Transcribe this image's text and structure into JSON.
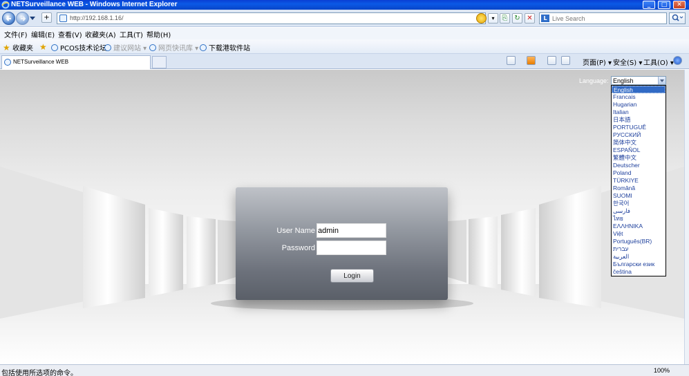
{
  "window": {
    "title": "NETSurveillance WEB - Windows Internet Explorer",
    "min": "_",
    "max": "□",
    "close": "✕"
  },
  "address": {
    "url": "http://192.168.1.16/",
    "search_placeholder": "Live Search"
  },
  "menu": [
    "文件(F)",
    "编辑(E)",
    "查看(V)",
    "收藏夹(A)",
    "工具(T)",
    "帮助(H)"
  ],
  "favorites": {
    "label": "收藏夹",
    "items": [
      "PCOS技术论坛",
      "建议网站 ▾",
      "网页快讯库 ▾",
      "下载港软件站"
    ]
  },
  "tab": {
    "title": "NETSurveillance WEB"
  },
  "commandbar": {
    "page": "页面(P) ▾",
    "safety": "安全(S) ▾",
    "tools": "工具(O) ▾"
  },
  "language": {
    "label": "Language:",
    "selected": "English",
    "options": [
      "English",
      "Francais",
      "Hugarian",
      "Italian",
      "日本語",
      "PORTUGUÊ",
      "РУССКИЙ",
      "简体中文",
      "ESPAÑOL",
      "繁體中文",
      "Deutscher",
      "Poland",
      "TÜRKIYE",
      "Română",
      "SUOMI",
      "한국어",
      "فارسی",
      "ไทย",
      "ΕΛΛΗΝΙΚΑ",
      "Việt",
      "Português(BR)",
      "עברית",
      "العربية",
      "Български език",
      "čeština"
    ]
  },
  "login": {
    "username_label": "User Name",
    "username_value": "admin",
    "password_label": "Password",
    "password_value": "",
    "button": "Login"
  },
  "status": {
    "text": "包括使用所选项的命令。",
    "zoom": "100%"
  }
}
